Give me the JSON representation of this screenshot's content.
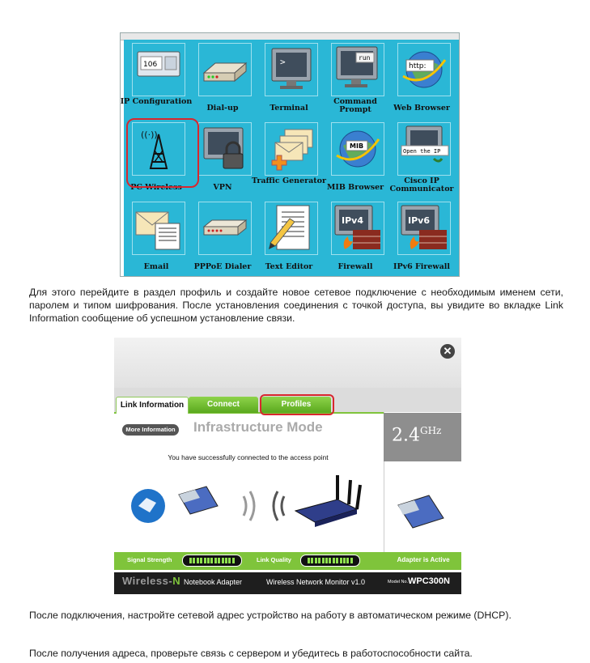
{
  "desktop": {
    "tiles": [
      {
        "label": "IP Configuration",
        "icon": "ip-configuration-icon",
        "screen_text": "106"
      },
      {
        "label": "Dial-up",
        "icon": "modem-icon"
      },
      {
        "label": "Terminal",
        "icon": "terminal-icon",
        "screen_text": ">"
      },
      {
        "label": "Command Prompt",
        "icon": "command-prompt-icon",
        "screen_text": "run"
      },
      {
        "label": "Web Browser",
        "icon": "web-browser-icon",
        "screen_text": "http:"
      },
      {
        "label": "PC Wireless",
        "icon": "wireless-tower-icon",
        "screen_text": "((·))"
      },
      {
        "label": "VPN",
        "icon": "vpn-lock-icon"
      },
      {
        "label": "Traffic Generator",
        "icon": "traffic-generator-icon"
      },
      {
        "label": "MIB Browser",
        "icon": "mib-browser-icon",
        "screen_text": "MIB"
      },
      {
        "label": "Cisco IP Communicator",
        "icon": "ip-communicator-icon",
        "screen_text": "Open the IP"
      },
      {
        "label": "Email",
        "icon": "email-icon"
      },
      {
        "label": "PPPoE Dialer",
        "icon": "pppoe-dialer-icon"
      },
      {
        "label": "Text Editor",
        "icon": "text-editor-icon"
      },
      {
        "label": "Firewall",
        "icon": "firewall-icon",
        "screen_text": "IPv4"
      },
      {
        "label": "IPv6 Firewall",
        "icon": "ipv6-firewall-icon",
        "screen_text": "IPv6"
      }
    ],
    "highlighted": "PC Wireless",
    "colors": {
      "background": "#2ab7d6",
      "highlight": "#d8272e"
    }
  },
  "paragraphs": {
    "p1": "Для этого перейдите в раздел профиль и создайте новое сетевое подключение с необходимым именем сети, паролем и типом шифрования. После установления соединения с точкой доступа, вы увидите во вкладке Link Information сообщение об успешном установление связи.",
    "p2": "После подключения, настройте сетевой адрес устройство на работу в автоматическом режиме (DHCP).",
    "p3": "После получения адреса, проверьте связь с сервером и убедитесь в работоспособности сайта."
  },
  "monitor": {
    "close_label": "✕",
    "tabs": [
      {
        "label": "Link Information",
        "state": "active"
      },
      {
        "label": "Connect",
        "state": "normal"
      },
      {
        "label": "Profiles",
        "state": "highlighted"
      }
    ],
    "more_info_label": "More Information",
    "mode_title": "Infrastructure Mode",
    "status_message": "You have successfully connected to the access point",
    "band": "2.4",
    "band_unit": "GHz",
    "signal_strength_label": "Signal Strength",
    "link_quality_label": "Link Quality",
    "adapter_status": "Adapter is Active",
    "footer": {
      "brand_main": "Wireless-",
      "brand_accent": "N",
      "product": "Notebook Adapter",
      "app_name": "Wireless Network Monitor  v1.0",
      "model_prefix": "Model No.",
      "model": "WPC300N"
    },
    "colors": {
      "accent_green": "#7fc43b",
      "highlight": "#d8272e",
      "footer_bg": "#1e1e1e"
    }
  }
}
